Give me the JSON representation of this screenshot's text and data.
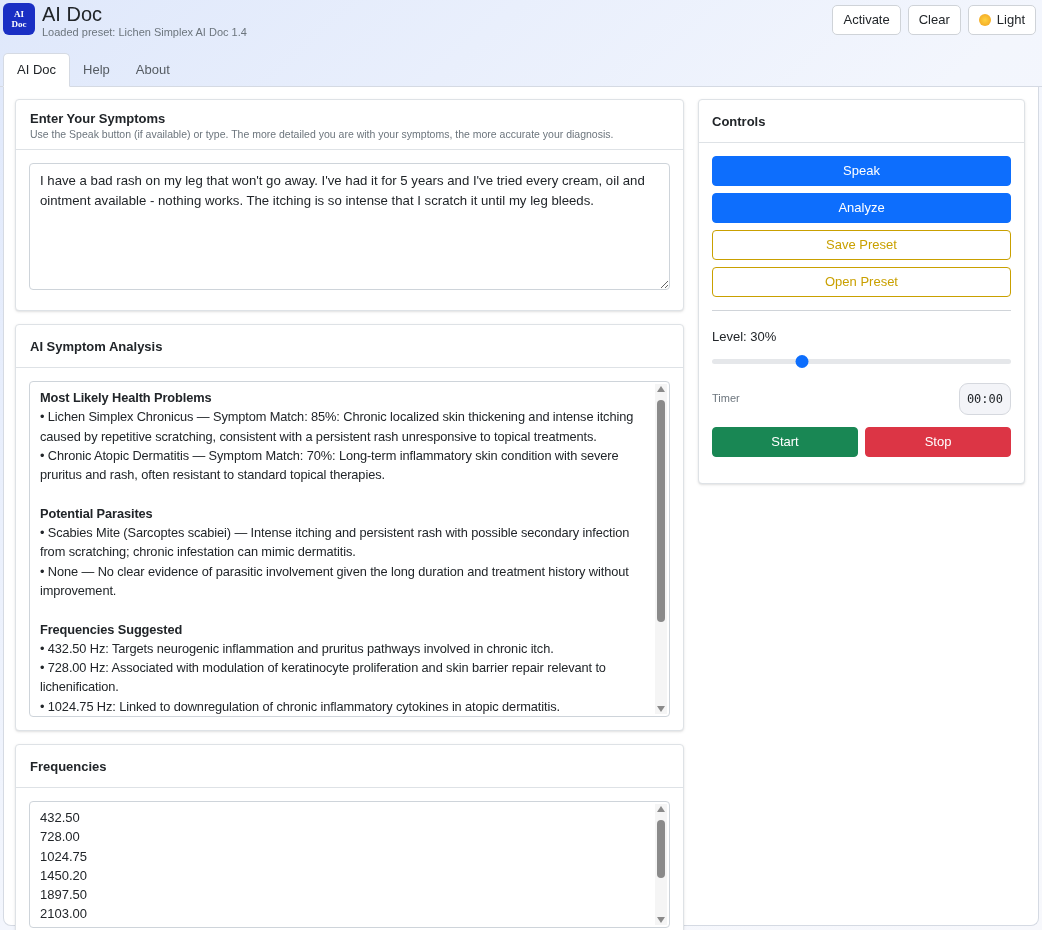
{
  "app": {
    "logo": "AI Doc",
    "title": "AI Doc",
    "subtitle": "Loaded preset: Lichen Simplex AI Doc 1.4"
  },
  "header_buttons": [
    {
      "label": "Activate",
      "kind": "plain"
    },
    {
      "label": "Clear",
      "kind": "plain"
    },
    {
      "label": "Light",
      "kind": "theme"
    }
  ],
  "tabs": [
    {
      "label": "AI Doc",
      "selected": true
    },
    {
      "label": "Help",
      "selected": false
    },
    {
      "label": "About",
      "selected": false
    }
  ],
  "symptoms": {
    "title": "Enter Your Symptoms",
    "hint": "Use the Speak button (if available) or type. The more detailed you are with your symptoms, the more accurate your diagnosis.",
    "value": "I have a bad rash on my leg that won't go away. I've had it for 5 years and I've tried every cream, oil and ointment available - nothing works. The itching is so intense that I scratch it until my leg bleeds."
  },
  "analysis": {
    "title": "AI Symptom Analysis",
    "sections": [
      {
        "heading": "Most Likely Health Problems",
        "items": [
          "• Lichen Simplex Chronicus — Symptom Match: 85%: Chronic localized skin thickening and intense itching caused by repetitive scratching, consistent with a persistent rash unresponsive to topical treatments.",
          "• Chronic Atopic Dermatitis — Symptom Match: 70%: Long-term inflammatory skin condition with severe pruritus and rash, often resistant to standard topical therapies."
        ]
      },
      {
        "heading": "Potential Parasites",
        "items": [
          "• Scabies Mite (Sarcoptes scabiei) — Intense itching and persistent rash with possible secondary infection from scratching; chronic infestation can mimic dermatitis.",
          "• None — No clear evidence of parasitic involvement given the long duration and treatment history without improvement."
        ]
      },
      {
        "heading": "Frequencies Suggested",
        "items": [
          "• 432.50 Hz: Targets neurogenic inflammation and pruritus pathways involved in chronic itch.",
          "• 728.00 Hz: Associated with modulation of keratinocyte proliferation and skin barrier repair relevant to lichenification.",
          "• 1024.75 Hz: Linked to downregulation of chronic inflammatory cytokines in atopic dermatitis."
        ]
      }
    ]
  },
  "frequencies": {
    "title": "Frequencies",
    "values": [
      "432.50",
      "728.00",
      "1024.75",
      "1450.20",
      "1897.50",
      "2103.00"
    ]
  },
  "controls": {
    "title": "Controls",
    "buttons": [
      {
        "label": "Speak",
        "kind": "primary"
      },
      {
        "label": "Analyze",
        "kind": "primary"
      },
      {
        "label": "Save Preset",
        "kind": "outline"
      },
      {
        "label": "Open Preset",
        "kind": "outline"
      }
    ],
    "level_label": "Level: 30%",
    "level": 0.3,
    "timer_label": "Timer",
    "timer": "00:00",
    "actions": [
      {
        "label": "Start",
        "kind": "success"
      },
      {
        "label": "Stop",
        "kind": "danger"
      }
    ]
  }
}
